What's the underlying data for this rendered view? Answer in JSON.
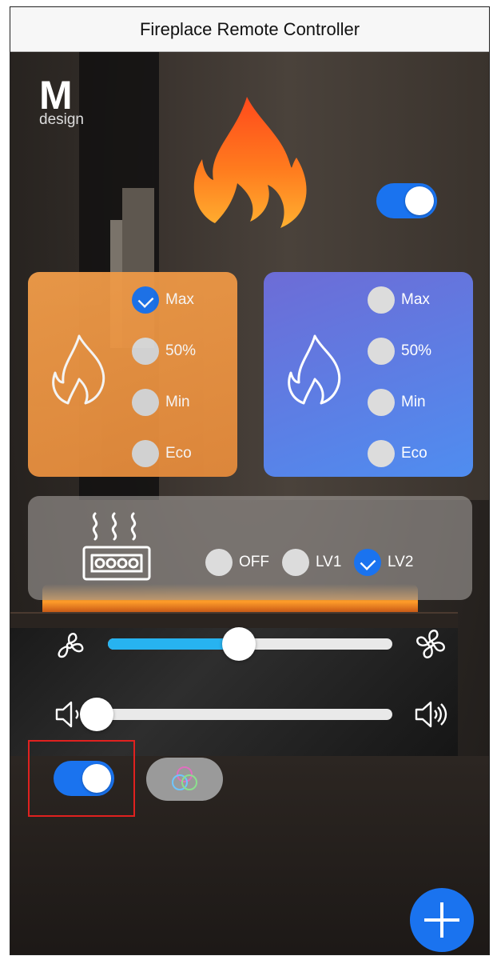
{
  "header": {
    "title": "Fireplace Remote Controller"
  },
  "logo": {
    "mark": "M",
    "word": "design"
  },
  "power_toggle": {
    "on": true
  },
  "flame_warm": {
    "icon": "flame-outline-icon",
    "options": [
      {
        "label": "Max",
        "checked": true
      },
      {
        "label": "50%",
        "checked": false
      },
      {
        "label": "Min",
        "checked": false
      },
      {
        "label": "Eco",
        "checked": false
      }
    ]
  },
  "flame_cool": {
    "icon": "flame-outline-icon",
    "options": [
      {
        "label": "Max",
        "checked": false
      },
      {
        "label": "50%",
        "checked": false
      },
      {
        "label": "Min",
        "checked": false
      },
      {
        "label": "Eco",
        "checked": false
      }
    ]
  },
  "heater": {
    "icon": "heater-icon",
    "options": [
      {
        "label": "OFF",
        "checked": false
      },
      {
        "label": "LV1",
        "checked": false
      },
      {
        "label": "LV2",
        "checked": true
      }
    ]
  },
  "fan_slider": {
    "value_fraction": 0.46,
    "min_icon": "fan-low-icon",
    "max_icon": "fan-high-icon"
  },
  "volume_slider": {
    "value_fraction": 0.0,
    "min_icon": "speaker-low-icon",
    "max_icon": "speaker-high-icon"
  },
  "light_toggle": {
    "on": true
  },
  "color_button": {
    "icon": "rgb-circles-icon"
  },
  "fab": {
    "icon": "plus-icon"
  },
  "colors": {
    "accent": "#1a73ef",
    "warm_card": "#e8913f",
    "cool_card": "#5b7ce6",
    "slider_fill": "#27b3f0",
    "highlight": "#e0211f"
  }
}
